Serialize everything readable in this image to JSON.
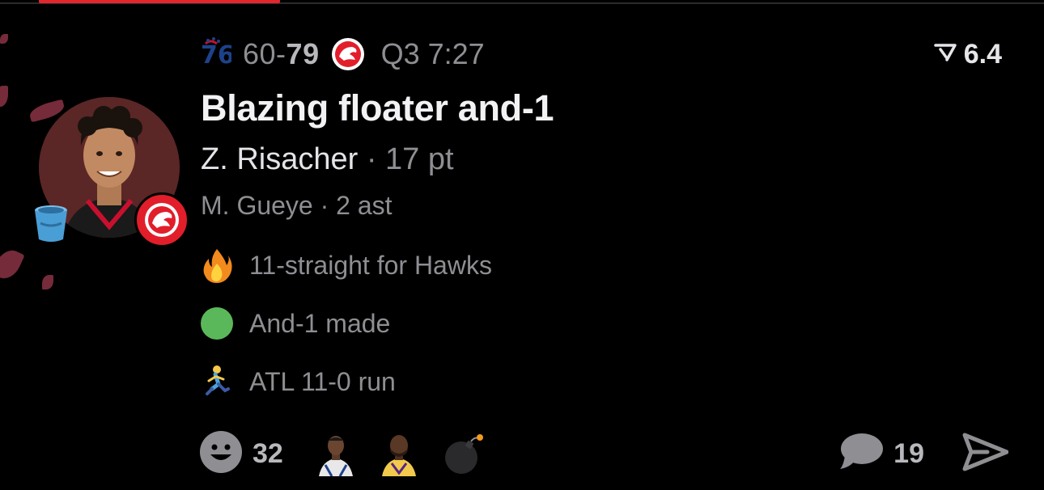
{
  "header": {
    "away_team_logo_icon": "sixers-76-logo-icon",
    "away_score": "60",
    "score_separator": "-",
    "home_score": "79",
    "home_team_logo_icon": "hawks-logo-icon",
    "game_clock": "Q3 7:27",
    "rating_icon": "rating-chevron-icon",
    "rating_value": "6.4"
  },
  "play": {
    "title": "Blazing floater and-1",
    "player_name": "Z. Risacher",
    "player_stat": " · 17 pt",
    "assist_line": "M. Gueye · 2 ast",
    "avatar_icon": "player-avatar",
    "team_badge_icon": "hawks-badge-icon",
    "bucket_icon": "bucket-icon"
  },
  "notes": [
    {
      "icon": "fire-icon",
      "text": "11-straight for Hawks"
    },
    {
      "icon": "green-circle-icon",
      "text": "And-1 made"
    },
    {
      "icon": "runner-icon",
      "text": "ATL 11-0 run"
    }
  ],
  "footer": {
    "reaction_icon": "smiley-icon",
    "reaction_count": "32",
    "reaction_faces": [
      "player-reaction-face-1",
      "player-reaction-face-2",
      "bomb-icon"
    ],
    "comment_icon": "comment-bubble-icon",
    "comment_count": "19",
    "share_icon": "send-icon"
  },
  "colors": {
    "background": "#000000",
    "accent_red": "#e3262e",
    "primary_text": "#f2f2f5",
    "secondary_text": "#8e8e93",
    "hawks_red": "#e21e2b"
  }
}
